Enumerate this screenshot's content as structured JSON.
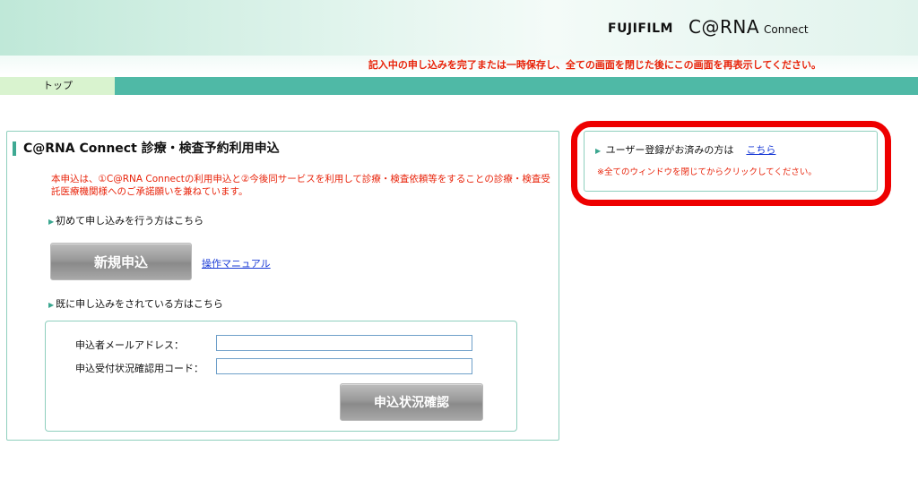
{
  "header": {
    "brand_fujifilm": "FUJIFILM",
    "brand_carna": "C@RNA",
    "brand_connect": "Connect",
    "notice": "記入中の申し込みを完了または一時保存し、全ての画面を閉じた後にこの画面を再表示してください。"
  },
  "nav": {
    "top_label": "トップ"
  },
  "application": {
    "title": "C@RNA Connect 診療・検査予約利用申込",
    "description": "本申込は、①C@RNA Connectの利用申込と②今後同サービスを利用して診療・検査依頼等をすることの診療・検査受託医療機関様へのご承諾願いを兼ねています。",
    "first_time_heading": "初めて申し込みを行う方はこちら",
    "new_application_button": "新規申込",
    "manual_link": "操作マニュアル",
    "existing_heading": "既に申し込みをされている方はこちら",
    "email_label": "申込者メールアドレス：",
    "email_value": "",
    "code_label": "申込受付状況確認用コード：",
    "code_value": "",
    "status_button": "申込状況確認"
  },
  "registered": {
    "text": "ユーザー登録がお済みの方は",
    "link": "こちら",
    "note": "※全てのウィンドウを閉じてからクリックしてください。"
  },
  "colors": {
    "accent": "#4fb9a6",
    "notice_red": "#e8230a",
    "highlight_red": "#ee0000",
    "link_blue": "#1a3bd6"
  }
}
